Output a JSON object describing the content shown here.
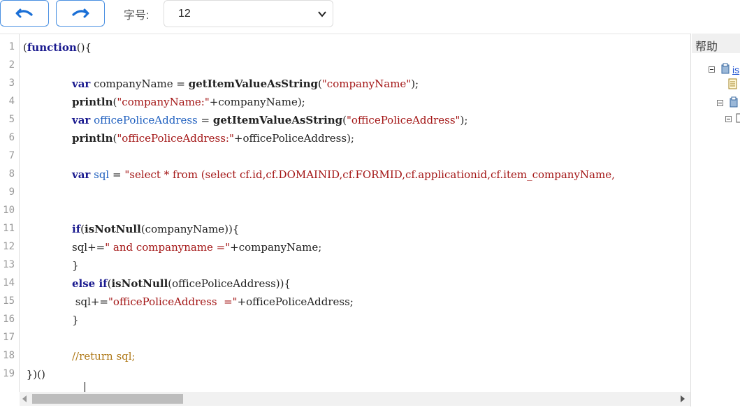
{
  "toolbar": {
    "undo_icon": "undo-icon",
    "redo_icon": "redo-icon",
    "font_size_label": "字号:",
    "font_size_value": "12",
    "accent": "#4a90e2"
  },
  "editor": {
    "line_numbers": [
      "1",
      "2",
      "3",
      "4",
      "5",
      "6",
      "7",
      "8",
      "9",
      "10",
      "11",
      "12",
      "13",
      "14",
      "15",
      "16",
      "17",
      "18",
      "19"
    ],
    "lines": {
      "l1": {
        "p1": "(",
        "kw": "function",
        "p2": "(){"
      },
      "l3": {
        "kw": "var",
        "p1": " companyName = ",
        "fn": "getItemValueAsString",
        "p2": "(",
        "str": "\"companyName\"",
        "p3": ");"
      },
      "l4": {
        "fn": "println",
        "p1": "(",
        "str": "\"companyName:\"",
        "p2": "+companyName);"
      },
      "l5": {
        "kw": "var",
        "sp": " ",
        "var": "officePoliceAddress",
        "p1": " = ",
        "fn": "getItemValueAsString",
        "p2": "(",
        "str": "\"officePoliceAddress\"",
        "p3": ");"
      },
      "l6": {
        "fn": "println",
        "p1": "(",
        "str": "\"officePoliceAddress:\"",
        "p2": "+officePoliceAddress);"
      },
      "l8": {
        "kw": "var",
        "sp": " ",
        "var": "sql",
        "p1": " = ",
        "str": "\"select * from (select cf.id,cf.DOMAINID,cf.FORMID,cf.applicationid,cf.item_companyName,"
      },
      "l11": {
        "kw": "if",
        "p1": "(",
        "fn": "isNotNull",
        "p2": "(companyName)){"
      },
      "l12": {
        "p1": "sql+=",
        "str": "\" and companyname =\"",
        "p2": "+companyName;"
      },
      "l13": {
        "p1": "}"
      },
      "l14": {
        "kw": "else if",
        "p1": "(",
        "fn": "isNotNull",
        "p2": "(officePoliceAddress)){"
      },
      "l15": {
        "p1": " sql+=",
        "str": "\"officePoliceAddress  =\"",
        "p2": "+officePoliceAddress;"
      },
      "l16": {
        "p1": "}"
      },
      "l18": {
        "cm1": "//",
        "cm2": "return sql;"
      },
      "l19": {
        "p1": " })()"
      }
    }
  },
  "help": {
    "title": "帮助",
    "nodes": [
      {
        "icon": "package-icon",
        "label": "is"
      },
      {
        "icon": "document-icon",
        "label": ""
      },
      {
        "icon": "package-icon",
        "label": ""
      },
      {
        "icon": "folder-icon",
        "label": ""
      }
    ]
  }
}
